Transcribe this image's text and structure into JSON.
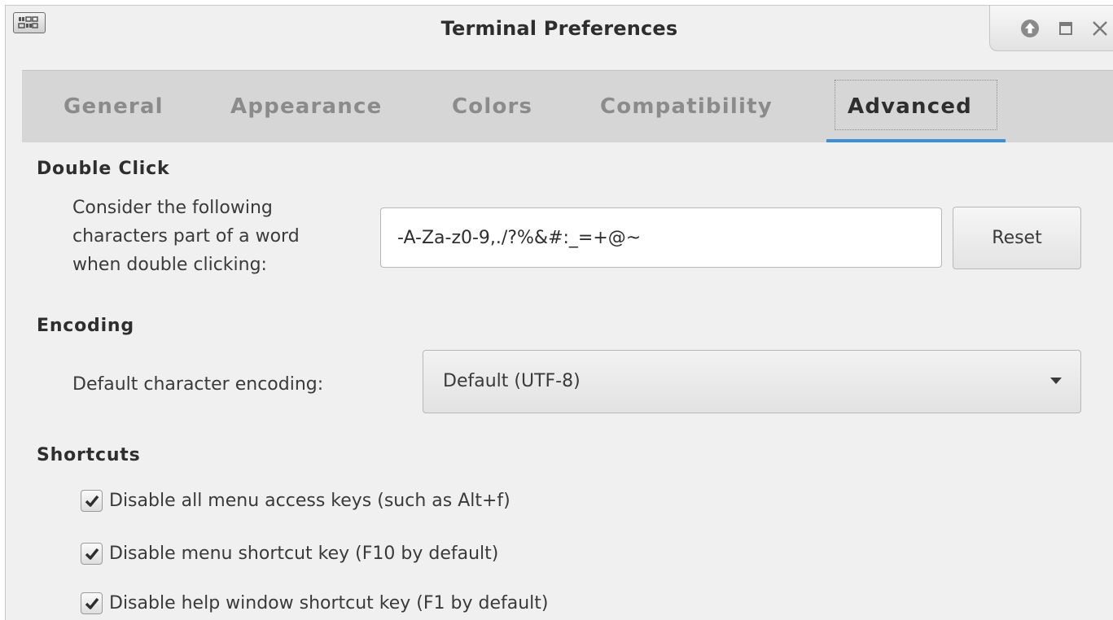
{
  "window": {
    "title": "Terminal Preferences",
    "controls": {
      "minimize_icon": "up-arrow-icon",
      "maximize_icon": "square-icon",
      "close_icon": "close-icon"
    }
  },
  "tabs": [
    {
      "label": "General",
      "active": false
    },
    {
      "label": "Appearance",
      "active": false
    },
    {
      "label": "Colors",
      "active": false
    },
    {
      "label": "Compatibility",
      "active": false
    },
    {
      "label": "Advanced",
      "active": true
    }
  ],
  "double_click": {
    "heading": "Double Click",
    "label_line1": "Consider the following",
    "label_line2": "characters part of a word",
    "label_line3": "when double clicking:",
    "value": "-A-Za-z0-9,./?%&#:_=+@~",
    "reset_label": "Reset"
  },
  "encoding": {
    "heading": "Encoding",
    "label": "Default character encoding:",
    "selected": "Default (UTF-8)"
  },
  "shortcuts": {
    "heading": "Shortcuts",
    "items": [
      {
        "label": "Disable all menu access keys (such as Alt+f)",
        "checked": true
      },
      {
        "label": "Disable menu shortcut key (F10 by default)",
        "checked": true
      },
      {
        "label": "Disable help window shortcut key (F1 by default)",
        "checked": true
      }
    ]
  },
  "colors": {
    "accent": "#3d8fd8",
    "window_bg": "#f0f0f0",
    "tabbar_bg": "#d6d6d6"
  }
}
